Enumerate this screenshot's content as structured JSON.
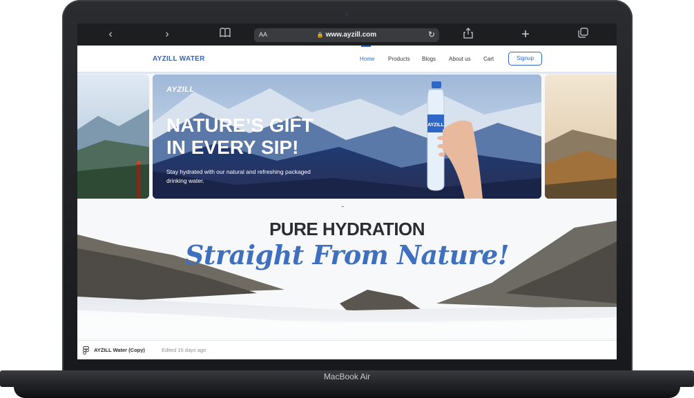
{
  "browser": {
    "url": "www.ayzill.com",
    "aa_label": "AA",
    "icons": [
      "back-icon",
      "forward-icon",
      "book-icon",
      "share-icon",
      "new-tab-icon",
      "tabs-icon",
      "reload-icon",
      "lock-icon"
    ]
  },
  "nav": {
    "brand": "AYZILL WATER",
    "links": [
      "Home",
      "Products",
      "Blogs",
      "About us",
      "Cart"
    ],
    "signup": "Signup",
    "accent": "#2f67c9"
  },
  "hero": {
    "logo": "AYZILL",
    "headline": "NATURE’S GIFT  IN EVERY SIP!",
    "subtext": "Stay hydrated with our natural and refreshing packaged drinking water.",
    "bottle_label": "AYZILL"
  },
  "carousel": {
    "dots": 5,
    "active": 1
  },
  "section": {
    "title": "PURE HYDRATION",
    "script": "Straight From Nature!"
  },
  "figma_bar": {
    "file": "AYZILL Water (Copy)",
    "edited": "Edited 16 days ago"
  },
  "device": {
    "label": "MacBook Air"
  }
}
